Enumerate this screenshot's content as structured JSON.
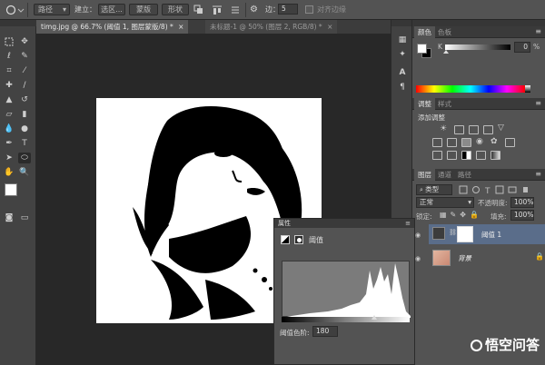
{
  "options_bar": {
    "mode_value": "路径",
    "build_label": "建立：",
    "selection_label": "选区...",
    "mask_label": "蒙版",
    "shape_label": "形状",
    "sides_label": "边：",
    "sides_value": "5",
    "align_label": "对齐边缘"
  },
  "tabs": [
    {
      "label": "timg.jpg @ 66.7% (阈值 1, 图层蒙版/8) *",
      "close": "×"
    },
    {
      "label": "未标题-1 @ 50% (图层 2, RGB/8) *",
      "close": "×"
    }
  ],
  "color_panel": {
    "tabs": [
      "颜色",
      "色板"
    ],
    "channel_label": "K",
    "value": "0",
    "unit": "%"
  },
  "adjustments_panel": {
    "tabs": [
      "调整",
      "样式"
    ],
    "title": "添加调整"
  },
  "layers_panel": {
    "tabs": [
      "图层",
      "通道",
      "路径"
    ],
    "kind_filter": "类型",
    "blend_mode": "正常",
    "opacity_label": "不透明度:",
    "opacity_value": "100%",
    "lock_label": "锁定:",
    "fill_label": "填充:",
    "fill_value": "100%",
    "layers": [
      {
        "name": "阈值 1",
        "selected": true
      },
      {
        "name": "背景",
        "selected": false
      }
    ]
  },
  "properties_panel": {
    "tab": "属性",
    "adjustment_name": "阈值",
    "threshold_label": "阈值色阶:",
    "threshold_value": "180"
  },
  "watermark": {
    "text": "悟空问答"
  },
  "colors": {
    "ui_dark": "#282828",
    "panel": "#535353",
    "selected_layer": "#5a6d8a"
  }
}
